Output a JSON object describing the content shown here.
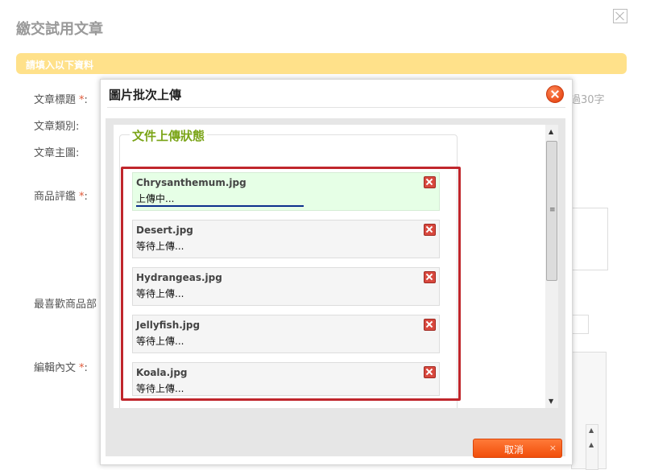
{
  "background": {
    "page_title": "繳交試用文章",
    "banner": "請填入以下資料",
    "fields": [
      {
        "label": "文章標題",
        "required": true
      },
      {
        "label": "文章類別",
        "required": false
      },
      {
        "label": "文章主圖",
        "required": false
      },
      {
        "label": "商品評鑑",
        "required": true
      },
      {
        "label": "最喜歡商品部",
        "required": false
      },
      {
        "label": "編輯內文",
        "required": true
      }
    ],
    "hint_fragment": "過30字"
  },
  "dialog": {
    "title": "圖片批次上傳",
    "legend": "文件上傳狀態",
    "cancel_label": "取消",
    "cancel_x": "×",
    "files": [
      {
        "name": "Chrysanthemum.jpg",
        "status": "上傳中...",
        "uploading": true,
        "progress": 0.52
      },
      {
        "name": "Desert.jpg",
        "status": "等待上傳...",
        "uploading": false
      },
      {
        "name": "Hydrangeas.jpg",
        "status": "等待上傳...",
        "uploading": false
      },
      {
        "name": "Jellyfish.jpg",
        "status": "等待上傳...",
        "uploading": false
      },
      {
        "name": "Koala.jpg",
        "status": "等待上傳...",
        "uploading": false
      }
    ]
  },
  "colors": {
    "banner": "#ffe18a",
    "legend_green": "#7aa417",
    "highlight_red": "#c0262c",
    "cancel_orange": "#f14e0b",
    "progress_blue": "#0b2f8c",
    "uploading_row": "#e6ffe6"
  },
  "icons": {
    "dialog_close": "close-circle-icon",
    "file_cancel": "remove-icon",
    "page_close": "close-icon"
  }
}
